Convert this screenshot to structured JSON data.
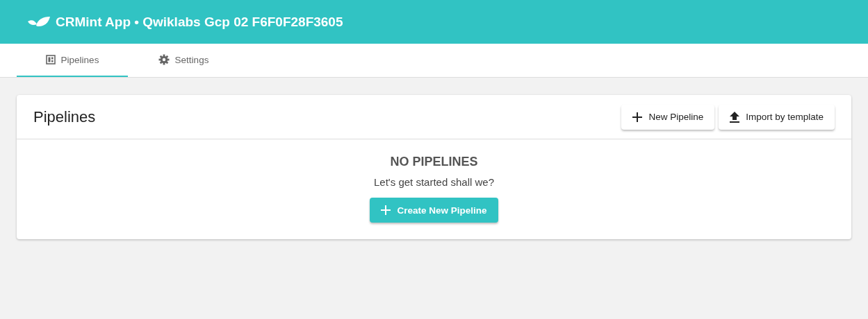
{
  "header": {
    "title": "CRMint App • Qwiklabs Gcp 02 F6F0F28F3605"
  },
  "tabs": [
    {
      "label": "Pipelines",
      "kind": "board",
      "selected": true
    },
    {
      "label": "Settings",
      "kind": "gear",
      "selected": false
    }
  ],
  "card": {
    "title": "Pipelines",
    "actions": [
      {
        "label": "New Pipeline",
        "kind": "plus"
      },
      {
        "label": "Import by template",
        "kind": "upload"
      }
    ],
    "empty_state": {
      "heading": "NO PIPELINES",
      "message": "Let's get started shall we?",
      "button": {
        "label": "Create New Pipeline",
        "kind": "plus"
      }
    }
  }
}
